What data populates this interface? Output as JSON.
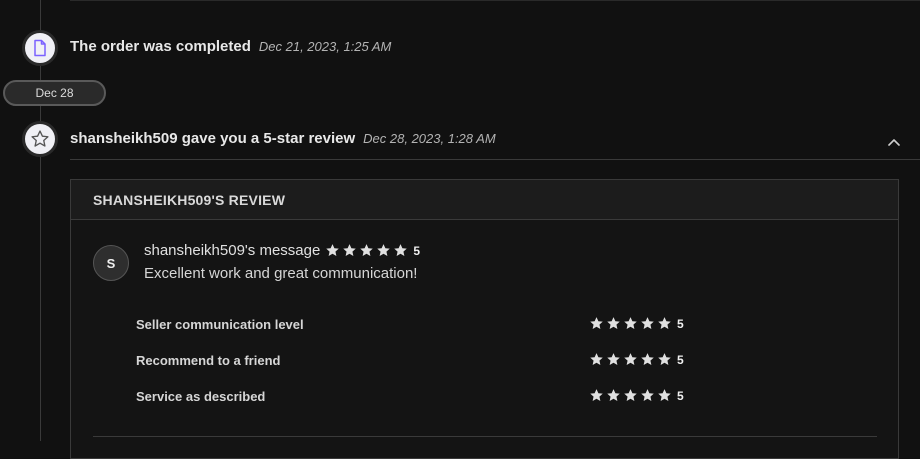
{
  "timeline": {
    "events": [
      {
        "title": "The order was completed",
        "time": "Dec 21, 2023, 1:25 AM",
        "icon": "document-icon"
      },
      {
        "title": "shansheikh509 gave you a 5-star review",
        "time": "Dec 28, 2023, 1:28 AM",
        "icon": "star-icon"
      }
    ],
    "date_separator": "Dec 28"
  },
  "review": {
    "header": "SHANSHEIKH509'S REVIEW",
    "avatar_initial": "S",
    "message_label": "shansheikh509's message",
    "message_score": "5",
    "message_text": "Excellent work and great communication!",
    "ratings": [
      {
        "label": "Seller communication level",
        "score": "5"
      },
      {
        "label": "Recommend to a friend",
        "score": "5"
      },
      {
        "label": "Service as described",
        "score": "5"
      }
    ]
  },
  "colors": {
    "background": "#111111",
    "icon_accent": "#7b61ff",
    "star": "#e0e0e0"
  }
}
